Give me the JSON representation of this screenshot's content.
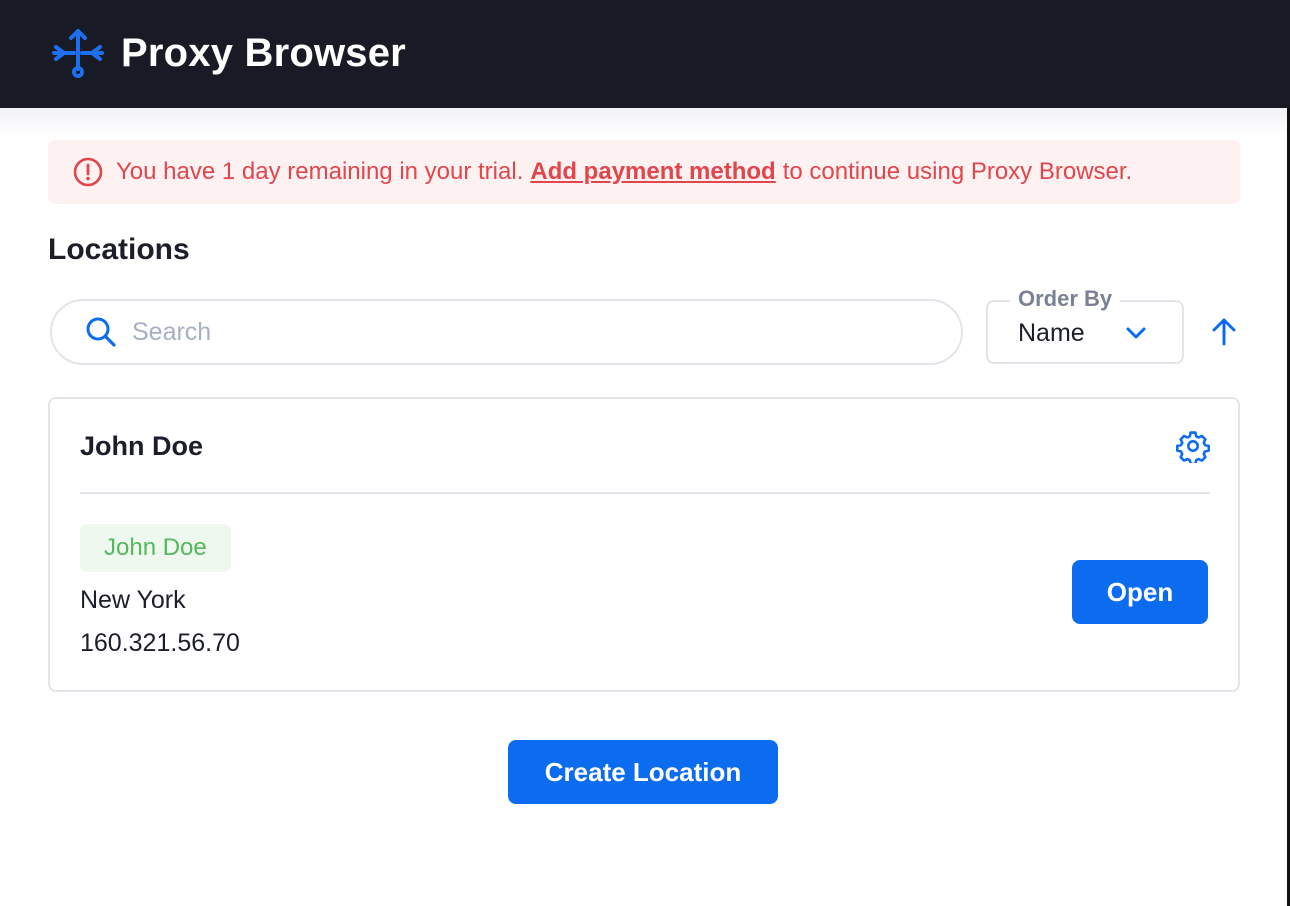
{
  "app": {
    "title": "Proxy Browser",
    "logo_icon": "routing-arrows-icon"
  },
  "colors": {
    "topbar_bg": "#181a26",
    "accent": "#0c6cf0",
    "alert_text": "#e0464c",
    "alert_bg": "#fdf1f1",
    "badge_text": "#54b85f",
    "badge_bg": "#eef8ee"
  },
  "alert": {
    "icon": "exclamation-circle-icon",
    "text_before": "You have 1 day remaining in your trial.",
    "link": "Add payment method",
    "text_after": "to continue using Proxy Browser."
  },
  "locations": {
    "title": "Locations",
    "search": {
      "placeholder": "Search",
      "value": "",
      "icon": "search-icon"
    },
    "order_by": {
      "label": "Order By",
      "value": "Name",
      "icon": "chevron-down-icon"
    },
    "sort_direction_icon": "arrow-up-icon",
    "items": [
      {
        "name": "John Doe",
        "settings_icon": "gear-icon",
        "tag": "John Doe",
        "city": "New York",
        "ip": "160.321.56.70",
        "open_label": "Open"
      }
    ]
  },
  "create_button": "Create Location"
}
